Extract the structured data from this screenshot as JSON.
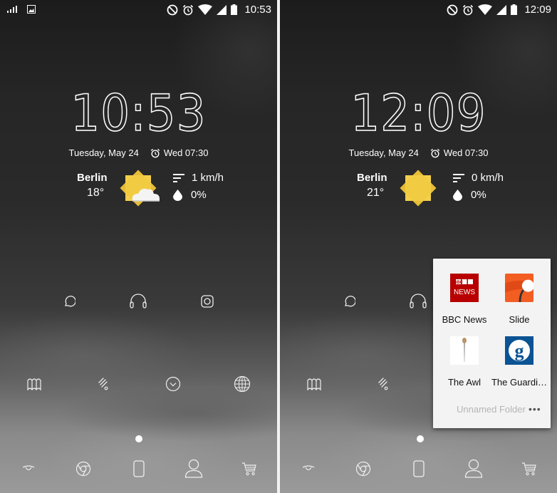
{
  "screens": [
    {
      "status_bar": {
        "left_icons": [
          "signal-bars-icon",
          "image-notification-icon"
        ],
        "right_icons": [
          "do-not-disturb-icon",
          "alarm-icon",
          "wifi-icon",
          "cell-signal-icon",
          "battery-icon"
        ],
        "time": "10:53"
      },
      "clock": "10:53",
      "date": "Tuesday, May 24",
      "alarm": "Wed 07:30",
      "weather": {
        "city": "Berlin",
        "temperature": "18°",
        "condition": "partly-cloudy",
        "wind": "1 km/h",
        "precipitation": "0%"
      },
      "home_row_1": [
        "chat-icon",
        "headphones-icon",
        "instagram-icon"
      ],
      "home_row_2": [
        "maps-icon",
        "feedly-icon",
        "app-drawer-icon",
        "browser-globe-icon"
      ],
      "page_indicator": {
        "pages": 1,
        "current": 1
      },
      "dock": [
        "eye-icon",
        "chrome-icon",
        "phone-icon",
        "contacts-icon",
        "shopping-cart-icon"
      ]
    },
    {
      "status_bar": {
        "right_icons": [
          "do-not-disturb-icon",
          "alarm-icon",
          "wifi-icon",
          "cell-signal-icon",
          "battery-icon"
        ],
        "time": "12:09"
      },
      "clock": "12:09",
      "date": "Tuesday, May 24",
      "alarm": "Wed 07:30",
      "weather": {
        "city": "Berlin",
        "temperature": "21°",
        "condition": "sunny",
        "wind": "0 km/h",
        "precipitation": "0%"
      },
      "folder": {
        "name": "Unnamed Folder",
        "more_label": "•••",
        "apps": [
          {
            "label": "BBC News",
            "icon": "bbc-news-icon",
            "icon_text_1": "BBC",
            "icon_text_2": "NEWS"
          },
          {
            "label": "Slide",
            "icon": "slide-icon"
          },
          {
            "label": "The Awl",
            "icon": "the-awl-icon"
          },
          {
            "label": "The Guardi…",
            "icon": "guardian-icon",
            "icon_text": "g"
          }
        ]
      }
    }
  ],
  "colors": {
    "sun": "#f3cf4a",
    "sun_dark": "#d9a92a",
    "bbc_red": "#b80000",
    "slide_orange": "#f25d22",
    "guardian_blue": "#0b5394",
    "folder_bg": "#f3f3f3"
  }
}
